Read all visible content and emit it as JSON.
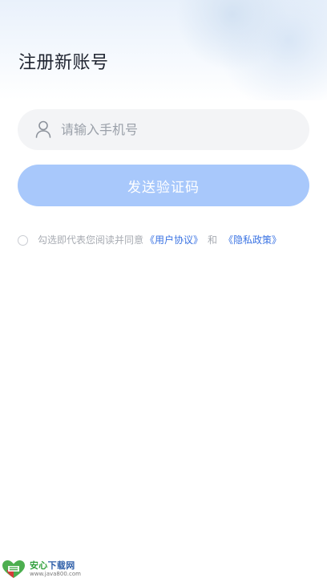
{
  "header": {
    "title": "注册新账号"
  },
  "phone_input": {
    "placeholder": "请输入手机号",
    "value": "",
    "icon": "user-icon"
  },
  "send_code_button": {
    "label": "发送验证码",
    "color": "#a8c8fb"
  },
  "agreement": {
    "text": "勾选即代表您阅读并同意",
    "user_agreement_link": "《用户协议》",
    "and_text": "和",
    "privacy_policy_link": "《隐私政策》",
    "checked": false,
    "link_color": "#3a73e3"
  },
  "watermark": {
    "title_part1": "安心",
    "title_part2": "下载网",
    "url": "www.java800.com"
  }
}
